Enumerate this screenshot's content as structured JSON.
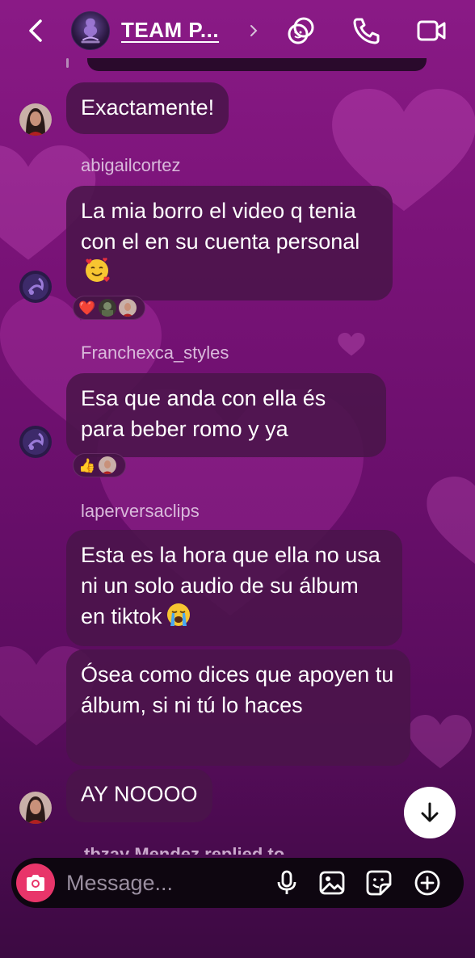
{
  "header": {
    "title": "TEAM P...",
    "icons": [
      "back-icon",
      "group-avatar",
      "chevron-right-icon",
      "effects-icon",
      "phone-icon",
      "video-icon"
    ]
  },
  "messages": [
    {
      "sender": "",
      "text": "Exactamente!",
      "avatar": "avatar-woman"
    },
    {
      "sender": "abigailcortez",
      "text": "La mia borro el video q tenia con el en su cuenta personal",
      "emoji": "smiling-face-with-hearts",
      "avatar": "avatar-scorpion",
      "reactions": [
        "❤️",
        "avatar",
        "avatar"
      ]
    },
    {
      "sender": "Franchexca_styles",
      "text": "Esa que anda con ella és para beber romo y ya",
      "avatar": "avatar-scorpion",
      "reactions": [
        "👍",
        "avatar"
      ]
    },
    {
      "sender": "laperversaclips",
      "text": "Esta es la hora que ella no usa ni un solo audio de su álbum en tiktok",
      "emoji": "loudly-crying-face"
    },
    {
      "sender": "",
      "text": "Ósea como dices que apoyen tu álbum, si ni tú lo haces"
    },
    {
      "sender": "",
      "text": "AY NOOOO",
      "avatar": "avatar-woman"
    }
  ],
  "peek_text": "tbzay Mendez replied to",
  "composer": {
    "placeholder": "Message...",
    "icons": [
      "camera-icon",
      "microphone-icon",
      "gallery-icon",
      "sticker-icon",
      "plus-circle-icon"
    ]
  },
  "colors": {
    "background_top": "#8a1a86",
    "background_bottom": "#3c0a42",
    "bubble": "#4a144a",
    "camera_button": "#e8356a",
    "sender_name": "#d9b9db"
  }
}
